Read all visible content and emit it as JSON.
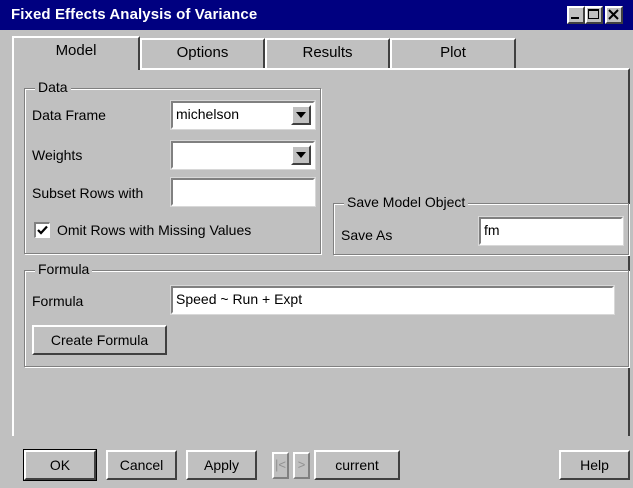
{
  "window": {
    "title": "Fixed Effects Analysis of Variance",
    "title_bar_color": "#000080"
  },
  "tabs": [
    {
      "label": "Model",
      "active": true
    },
    {
      "label": "Options",
      "active": false
    },
    {
      "label": "Results",
      "active": false
    },
    {
      "label": "Plot",
      "active": false
    }
  ],
  "data_group": {
    "label": "Data",
    "data_frame_label": "Data Frame",
    "data_frame_value": "michelson",
    "weights_label": "Weights",
    "weights_value": "",
    "subset_label": "Subset Rows with",
    "subset_value": "",
    "omit_missing_label": "Omit Rows with Missing Values",
    "omit_missing_checked": true
  },
  "save_group": {
    "label": "Save Model Object",
    "save_as_label": "Save As",
    "save_as_value": "fm"
  },
  "formula_group": {
    "label": "Formula",
    "formula_label": "Formula",
    "formula_value": "Speed ~ Run + Expt",
    "create_formula_label": "Create Formula"
  },
  "footer": {
    "ok_label": "OK",
    "cancel_label": "Cancel",
    "apply_label": "Apply",
    "prev_label": "|<",
    "next_label": ">",
    "current_label": "current",
    "help_label": "Help"
  },
  "icons": {
    "minimize": "minimize-icon",
    "maximize": "maximize-icon",
    "close": "close-icon",
    "dropdown": "chevron-down-icon",
    "check": "check-icon"
  }
}
